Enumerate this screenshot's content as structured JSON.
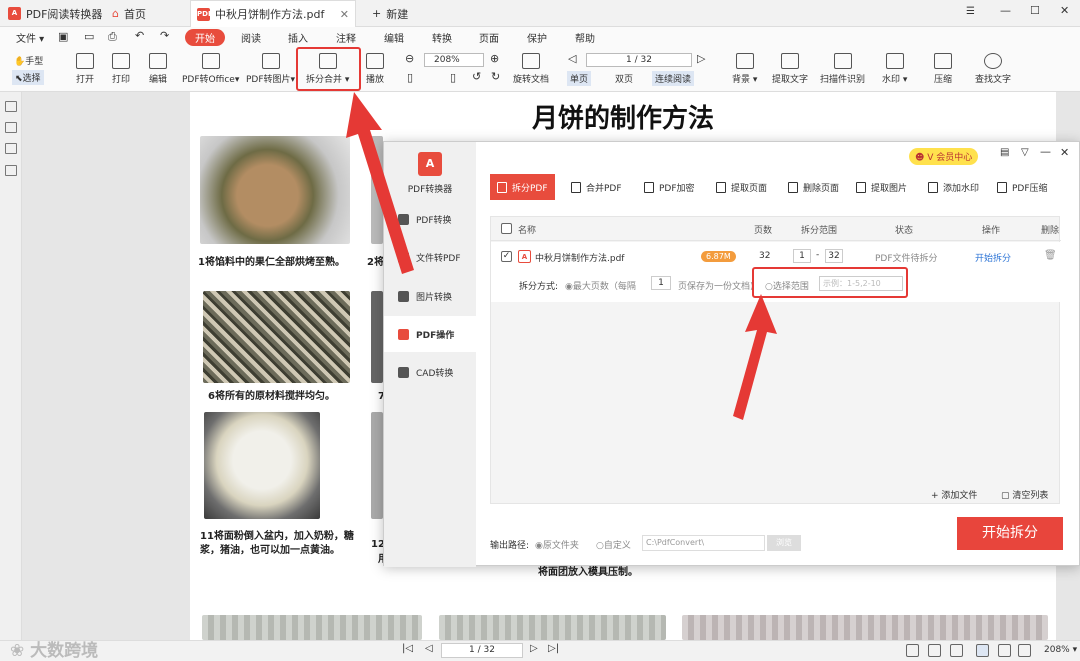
{
  "tabs": [
    {
      "label": "PDF阅读转换器"
    },
    {
      "label": "首页"
    },
    {
      "label": "中秋月饼制作方法.pdf"
    },
    {
      "label": "新建"
    }
  ],
  "menu": {
    "file": "文件",
    "items": [
      "开始",
      "阅读",
      "插入",
      "注释",
      "编辑",
      "转换",
      "页面",
      "保护",
      "帮助"
    ]
  },
  "toolbar": {
    "hand": "手型",
    "select": "选择",
    "open": "打开",
    "print": "打印",
    "edit": "编辑",
    "pdf_to_office": "PDF转Office",
    "pdf_to_image": "PDF转图片",
    "split_merge": "拆分合并",
    "play": "播放",
    "zoom": "208%",
    "rotate": "旋转文档",
    "page_indicator": "1 / 32",
    "single": "单页",
    "double": "双页",
    "continuous": "连续阅读",
    "background": "背景",
    "extract_text": "提取文字",
    "scan_ocr": "扫描件识别",
    "watermark": "水印",
    "compress": "压缩",
    "find_text": "查找文字"
  },
  "document": {
    "title": "月饼的制作方法",
    "cap1": "1将馅料中的果仁全部烘烤至熟。",
    "cap2": "2将",
    "cap6": "6将所有的原材料搅拌均匀。",
    "cap7": "7",
    "cap11": "11将面粉倒入盆内，加入奶粉，糖浆，猪油，也可以加一点黄油。",
    "cap12a": "12",
    "cap12b": "用",
    "cap_bottom": "将面团放入模具压制。"
  },
  "dialog": {
    "app_name": "PDF转换器",
    "vip": "会员中心",
    "nav": [
      "PDF转换",
      "文件转PDF",
      "图片转换",
      "PDF操作",
      "CAD转换"
    ],
    "tabs": [
      "拆分PDF",
      "合并PDF",
      "PDF加密",
      "提取页面",
      "删除页面",
      "提取图片",
      "添加水印",
      "PDF压缩"
    ],
    "headers": {
      "name": "名称",
      "pages": "页数",
      "range": "拆分范围",
      "status": "状态",
      "action": "操作",
      "delete": "删除"
    },
    "file": {
      "name": "中秋月饼制作方法.pdf",
      "size": "6.87M",
      "pages": "32",
      "range_from": "1",
      "range_to": "32",
      "status": "PDF文件待拆分",
      "action": "开始拆分"
    },
    "split": {
      "label": "拆分方式:",
      "opt1": "最大页数（每隔",
      "every": "1",
      "opt1_tail": "页保存为一份文档)",
      "opt2": "选择范围",
      "placeholder": "示例：1-5,2-10"
    },
    "add_file": "添加文件",
    "clear_list": "清空列表",
    "output": {
      "label": "输出路径:",
      "orig": "原文件夹",
      "custom": "自定义",
      "path": "C:\\PdfConvert\\",
      "browse": "浏览"
    },
    "start": "开始拆分"
  },
  "bottom": {
    "page": "1 / 32",
    "zoom": "208%"
  },
  "watermark_text": "大数跨境",
  "colors": {
    "accent": "#e84c3d",
    "annotation": "#e53935"
  }
}
